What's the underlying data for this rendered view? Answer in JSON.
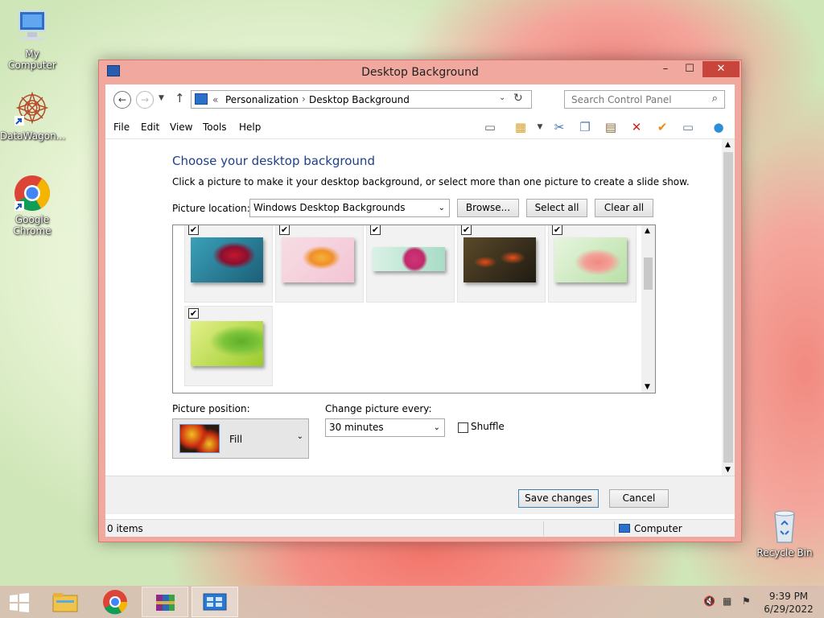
{
  "desktop": {
    "icons": [
      {
        "label": "My Computer"
      },
      {
        "label": "DataWagon..."
      },
      {
        "label": "Google Chrome"
      },
      {
        "label": "Recycle Bin"
      }
    ]
  },
  "window": {
    "title": "Desktop Background",
    "controls": {
      "minimize": "–",
      "maximize": "☐",
      "close": "✕"
    },
    "address": {
      "prefix": "«",
      "crumbs": [
        "Personalization",
        "Desktop Background"
      ],
      "separator": "›",
      "search_placeholder": "Search Control Panel"
    },
    "menu": [
      "File",
      "Edit",
      "View",
      "Tools",
      "Help"
    ],
    "heading": "Choose your desktop background",
    "description": "Click a picture to make it your desktop background, or select more than one picture to create a slide show.",
    "picture_location": {
      "label": "Picture location:",
      "value": "Windows Desktop Backgrounds"
    },
    "buttons": {
      "browse": "Browse...",
      "select_all": "Select all",
      "clear_all": "Clear all",
      "save": "Save changes",
      "cancel": "Cancel"
    },
    "pictures": [
      {
        "name": "red flower on teal",
        "checked": true
      },
      {
        "name": "orange flower on pink",
        "checked": true
      },
      {
        "name": "pink flower on mint",
        "checked": true
      },
      {
        "name": "red tulips dark",
        "checked": true
      },
      {
        "name": "pink flower on green",
        "checked": true
      },
      {
        "name": "green leaves",
        "checked": true
      }
    ],
    "picture_position": {
      "label": "Picture position:",
      "value": "Fill"
    },
    "change_picture": {
      "label": "Change picture every:",
      "value": "30 minutes"
    },
    "shuffle": {
      "label": "Shuffle",
      "checked": false
    },
    "status": {
      "items": "0 items",
      "computer": "Computer"
    }
  },
  "taskbar": {
    "clock": {
      "time": "9:39 PM",
      "date": "6/29/2022"
    }
  }
}
